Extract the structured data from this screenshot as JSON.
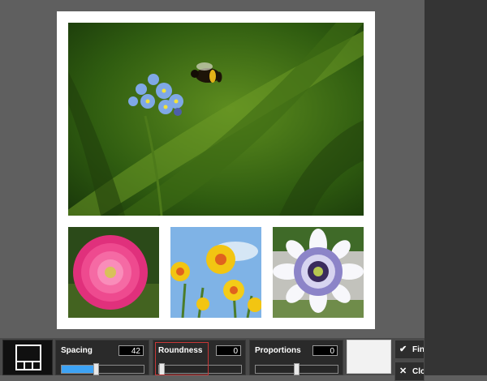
{
  "toolbar": {
    "spacing": {
      "label": "Spacing",
      "value": "42",
      "level": 0.42
    },
    "roundness": {
      "label": "Roundness",
      "value": "0",
      "level": 0
    },
    "proportions": {
      "label": "Proportions",
      "value": "0",
      "level": 0.5
    },
    "finish_label": "Fin",
    "close_label": "Clo"
  },
  "icons": {
    "layout": "collage-layout-icon",
    "finish": "checkmark-icon",
    "close": "close-icon"
  },
  "colors": {
    "slider_fill": "#3da3f5",
    "canvas_background": "#ffffff",
    "highlight": "#c83737"
  }
}
